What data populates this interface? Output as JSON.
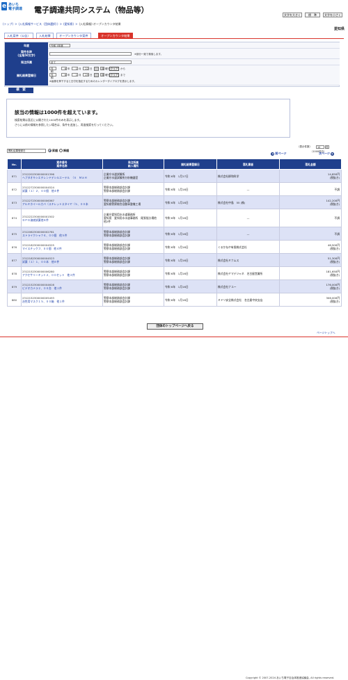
{
  "header": {
    "logo_text_1": "あいち",
    "logo_text_2": "電子調達",
    "system_title": "電子調達共同システム（物品等）",
    "tool_buttons": [
      "文字を大きく",
      "標　準",
      "文字を小さく"
    ],
    "prefecture": "愛知県"
  },
  "breadcrumb": [
    "(トップ)",
    ">",
    "(入札情報サービス（団体選択）)",
    ">",
    "(愛知県)",
    ">",
    "(入札情報):オープンカウンタ結果"
  ],
  "tabs": [
    {
      "label": "入札案件（公告）",
      "active": false
    },
    {
      "label": "入札結果",
      "active": false
    },
    {
      "label": "オープンカウンタ案件",
      "active": false
    },
    {
      "label": "オープンカウンタ結果",
      "active": true
    }
  ],
  "form": {
    "year_label": "年度",
    "year_value": "令和 5年度",
    "case_label": "案件名称\n(全角50文字)",
    "case_value": "",
    "case_note": "※部分一致で検索します。",
    "dept_label": "発注所属",
    "dept_value": "全て",
    "date_label": "開札結果登録日",
    "era": "令和",
    "from": {
      "year": "6",
      "month": "1",
      "day": "22"
    },
    "to": {
      "year": "6",
      "month": "1",
      "day": "29"
    },
    "year_unit": "年",
    "month_unit": "月",
    "day_unit": "日",
    "weekday_label": "曜日",
    "from_weekday": "月",
    "to_weekday": "月",
    "clear_label": "クリア",
    "from_suffix": "から",
    "to_suffix": "まで",
    "cal_note": "※画像を押下すると日付を指定するためのカレンダーダイアログを表示します。"
  },
  "search_button": "検　索",
  "message": {
    "title": "該当の情報は1000件を超えています。",
    "line1": "検索結果は直近に公開された1000件のみを表示します。",
    "line2": "さらに以前の情報を参照したい場合は、条件を追加し、再度検索を行ってください。"
  },
  "sort": {
    "select_value": "開札結果登録日",
    "asc_label": "昇順",
    "desc_label": "降順",
    "selected": "asc"
  },
  "paging": {
    "count_text": "（表示件数）",
    "per_page_value": "10",
    "per_page_unit": "件",
    "total_text": "（1000件中）",
    "range_text": "871 - 880",
    "prev_label": "前ページ",
    "next_label": "次ページ",
    "prev_icon": "chevron-left",
    "next_icon": "chevron-right"
  },
  "table": {
    "headers": [
      "No.",
      "案件番号\n案件名称",
      "発注所属\n納入場所",
      "開札結果登録日",
      "落札業者",
      "落札金額"
    ],
    "rows": [
      {
        "no": "871",
        "id": "2312202300000001396",
        "name": "ヘプタオキシエチレンドデシルエーテル　（ｎ　ＭａＨ",
        "dept": "企業庁水道試験所",
        "place": "企業庁水道試験所分析機器室",
        "date": "令和 6年　1月17日",
        "vendor": "株式会社柳和科学",
        "amount": "14,850円",
        "note": "(税抜き)"
      },
      {
        "no": "872",
        "id": "2312272300000004524",
        "name": "試薬（１）２、００個　他４件",
        "dept": "警察本部総務部会計課",
        "place": "警察本部総務部会計課",
        "date": "令和 6年　1月16日",
        "vendor": "—",
        "amount": "不調",
        "note": ""
      },
      {
        "no": "873",
        "id": "2312272300000006367",
        "name": "アルミホイールカバ（スキレットスタイヤ（５、００本",
        "dept": "警察本部総務部会計課",
        "place": "愛知県警察総合自動車整備工場",
        "date": "令和 6年　1月16日",
        "vendor": "株式会社中島　55 (株)",
        "amount": "142,200円",
        "note": "(税抜き)"
      },
      {
        "no": "874",
        "id": "2312222300000001502",
        "name": "ＤＰＤ溶液試薬他８件",
        "dept": "企業庁愛知用水水道事務所",
        "place": "愛知用　愛知用水水道事務所　尾張旭分場他",
        "place2": "他2件",
        "date": "令和 6年　1月16日",
        "vendor": "—",
        "amount": "不調",
        "note": ""
      },
      {
        "no": "875",
        "id": "2312062300000002781",
        "name": "ストライクシャツ４、００個　他５件",
        "dept": "警察本部総務部会計課",
        "place": "警察本部総務部会計課",
        "date": "令和 6年　1月16日",
        "vendor": "—",
        "amount": "不調",
        "note": ""
      },
      {
        "no": "876",
        "id": "2312182300000004525",
        "name": "マイスチックフ、００個　他４件",
        "dept": "警察本部総務部会計課",
        "place": "警察本部総務部会計課",
        "date": "令和 6年　1月16日",
        "vendor": "くるかねや有限株式会社",
        "amount": "46,500円",
        "note": "(税抜き)"
      },
      {
        "no": "877",
        "id": "2312182300000004523",
        "name": "試薬（１）１、００本　他８件",
        "dept": "警察本部総務部会計課",
        "place": "警察本部総務部会計課",
        "date": "令和 6年　1月16日",
        "vendor": "株式会社ミナムス",
        "amount": "51,300円",
        "note": "(税抜き)"
      },
      {
        "no": "878",
        "id": "2312152300000006280",
        "name": "アクセサリーキット２、００セット　他３件",
        "dept": "警察本部総務部会計課",
        "place": "警察本部総務部会計課",
        "date": "令和 6年　1月16日",
        "vendor": "株式会社ヤマデジャネ　名古屋営業所",
        "amount": "181,650円",
        "note": "(税抜き)"
      },
      {
        "no": "879",
        "id": "2312152300000004616",
        "name": "ビデオカメラ２、００台　他１件",
        "dept": "警察本部総務部会計課",
        "place": "警察本部総務部会計課",
        "date": "令和 6年　1月16日",
        "vendor": "株式会社ナユー",
        "amount": "176,000円",
        "note": "(税抜き)"
      },
      {
        "no": "880",
        "id": "2312152300000005493",
        "name": "治性用マスク１５、００箱　他１件",
        "dept": "警察本部総務部会計課",
        "place": "警察本部総務部会計課",
        "date": "令和 6年　1月16日",
        "vendor": "ミドリ安全株式会社　名古屋中央支店",
        "amount": "306,000円",
        "note": "(税抜き)"
      }
    ]
  },
  "top_button": "団体のトップページへ戻る",
  "page_top": "ページトップへ",
  "copyright": "Copyright © 2007-2024 あいち電子自治体推進協議会, All rights reserved."
}
